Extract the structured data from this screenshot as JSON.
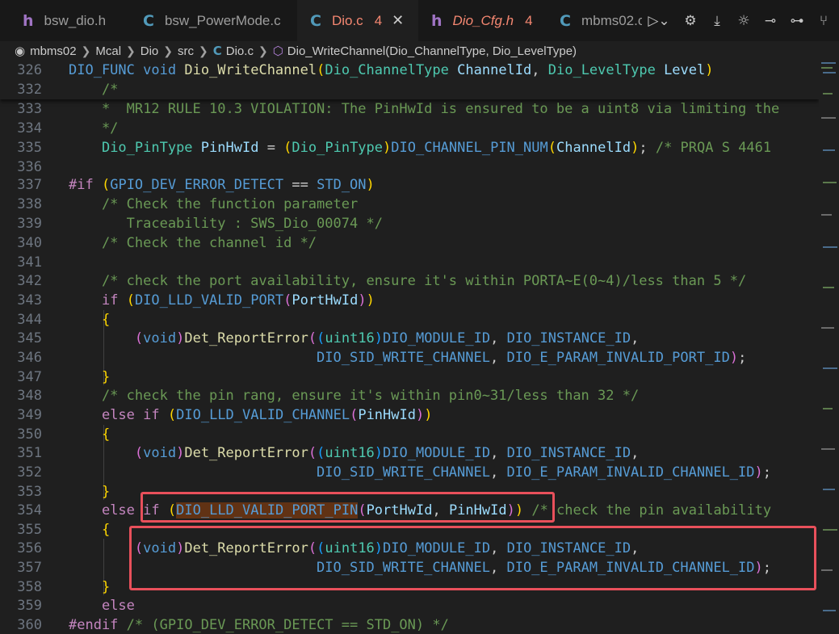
{
  "tabs": [
    {
      "icon": "h",
      "label": "bsw_dio.h",
      "active": false
    },
    {
      "icon": "C",
      "label": "bsw_PowerMode.c",
      "active": false
    },
    {
      "icon": "C",
      "label": "Dio.c",
      "active": true,
      "problems": "4"
    },
    {
      "icon": "h",
      "label": "Dio_Cfg.h",
      "active": false,
      "problems": "4"
    },
    {
      "icon": "C",
      "label": "mbms02.c",
      "active": false
    }
  ],
  "breadcrumb": {
    "root": "mbms02",
    "items": [
      "Mcal",
      "Dio",
      "src",
      "Dio.c"
    ],
    "symbol": "Dio_WriteChannel(Dio_ChannelType, Dio_LevelType)"
  },
  "editor": {
    "sticky_line": {
      "number": "326"
    },
    "line_numbers": [
      "332",
      "333",
      "334",
      "335",
      "336",
      "337",
      "338",
      "339",
      "340",
      "341",
      "342",
      "343",
      "344",
      "345",
      "346",
      "347",
      "348",
      "349",
      "350",
      "351",
      "352",
      "353",
      "354",
      "355",
      "356",
      "357",
      "358",
      "359",
      "360"
    ]
  },
  "colors": {
    "accent": "#e8505b",
    "keyword": "#569cd6",
    "comment": "#6a9955",
    "type": "#4ec9b0",
    "function": "#dcdcaa"
  }
}
